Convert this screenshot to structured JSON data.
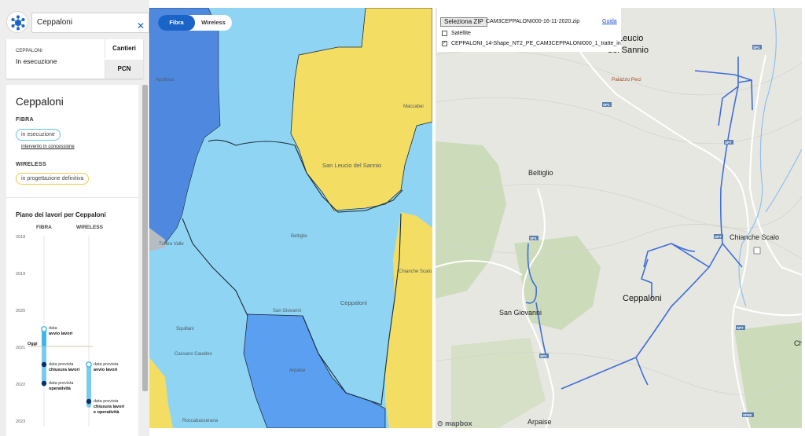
{
  "search": {
    "value": "Ceppaloni",
    "clear_icon": "close-icon"
  },
  "status_card": {
    "city": "CEPPALONI",
    "state": "In esecuzione",
    "cantieri_label": "Cantieri",
    "pcn_label": "PCN"
  },
  "detail": {
    "title": "Ceppaloni",
    "fibra_label": "FIBRA",
    "fibra_status": "in esecuzione",
    "fibra_link": "intervento in concessione",
    "wireless_label": "WIRELESS",
    "wireless_status": "in progettazione definitiva",
    "plan_title": "Piano dei lavori per Ceppaloni",
    "col_fibra": "FIBRA",
    "col_wireless": "WIRELESS",
    "years": [
      "2018",
      "2019",
      "2020",
      "2021",
      "2022",
      "2023"
    ],
    "today_label": "Oggi",
    "fibra_events": [
      {
        "line1": "data",
        "line2": "avvio lavori"
      },
      {
        "line1": "data prevista",
        "line2": "chiusura lavori"
      },
      {
        "line1": "data prevista",
        "line2": "operatività"
      }
    ],
    "wireless_events": [
      {
        "line1": "data prevista",
        "line2": "avvio lavori",
        "line3": ""
      },
      {
        "line1": "data prevista",
        "line2": "chiusura lavori",
        "line3": "e operatività"
      }
    ]
  },
  "middle_map": {
    "toggle": {
      "fibra": "Fibra",
      "wireless": "Wireless"
    },
    "places": [
      "Apollosa",
      "San Leucio del Sannio",
      "Maccabei",
      "Beltiglio",
      "Chianche Scalo",
      "Ceppaloni",
      "San Giovanni",
      "Arpaise",
      "Cassano Caudino",
      "Squillani",
      "Roccabascerana",
      "Tufara Valle"
    ],
    "colors": {
      "blue_dark": "#4f89df",
      "blue_mid": "#5a9ff0",
      "light_blue": "#8fd5f3",
      "yellow": "#f4dd63",
      "grey": "#b5bcc2"
    }
  },
  "right_map": {
    "zip_button": "Seleziona ZIP",
    "zip_file": "CAM3CEPPALONI000-16-11-2020.zip",
    "guide": "Guida",
    "satellite_label": "Satellite",
    "layer_label": "CEPPALONI_14-Shape_NT2_PE_CAM3CEPPALONI000_1_tratte_in",
    "places": {
      "leucio": "Leucio",
      "sannio": "del Sannio",
      "palazzo": "Palazzo Peci",
      "beltiglio": "Beltiglio",
      "chianche": "Chianche Scalo",
      "ceppaloni": "Ceppaloni",
      "san_giovanni": "San Giovanni",
      "arpaise": "Arpaise",
      "ch": "Ch"
    },
    "roads": [
      "SP1",
      "SP1",
      "SP7",
      "SP7",
      "SP7",
      "SP1",
      "SP1",
      "SP7",
      "SP88"
    ],
    "attribution": "mapbox",
    "colors": {
      "line": "#3f6ed8",
      "river": "#8fbff0",
      "green": "#c5d7b0",
      "road": "#ffffff"
    }
  }
}
